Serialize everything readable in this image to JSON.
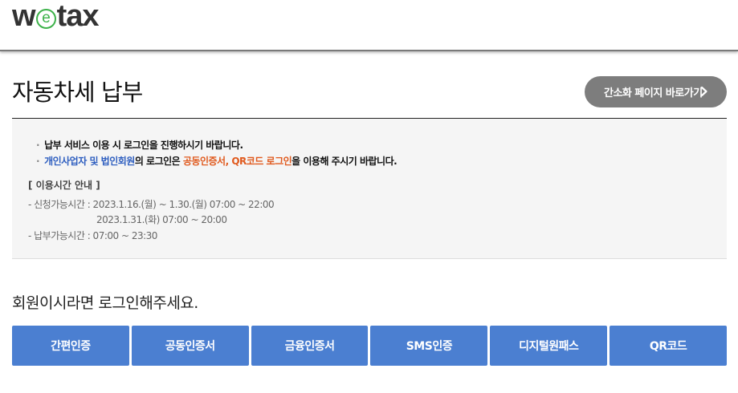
{
  "header": {
    "logo_w": "w",
    "logo_e": "e",
    "logo_rest": "tax"
  },
  "page": {
    "title": "자동차세 납부",
    "simple_page_button": "간소화 페이지 바로가기"
  },
  "notice": {
    "bullet_mark": "·",
    "line1": "납부 서비스 이용 시 로그인을 진행하시기 바랍니다.",
    "line2_part1": "개인사업자 및 법인회원",
    "line2_part2": "의 로그인은 ",
    "line2_part3": "공동인증서, QR코드 로그인",
    "line2_part4": "을 이용해 주시기 바랍니다.",
    "guide_title": "[ 이용시간 안내 ]",
    "guide_lines": [
      "- 신청가능시간 : 2023.1.16.(월) ~ 1.30.(월) 07:00 ~ 22:00",
      "2023.1.31.(화) 07:00 ~ 20:00",
      "- 납부가능시간 : 07:00 ~ 23:30"
    ]
  },
  "login_message": "회원이시라면 로그인해주세요.",
  "auth_buttons": [
    "간편인증",
    "공동인증서",
    "금융인증서",
    "SMS인증",
    "디지털원패스",
    "QR코드"
  ],
  "colors": {
    "auth_button_bg": "#4b7fd1",
    "simple_button_bg": "#7d7d7d",
    "logo_green": "#3db24a",
    "highlight_blue": "#2f5fc0",
    "highlight_orange": "#e05a1e"
  },
  "icons": {
    "simple_button_icon": "chevron-right-icon"
  }
}
